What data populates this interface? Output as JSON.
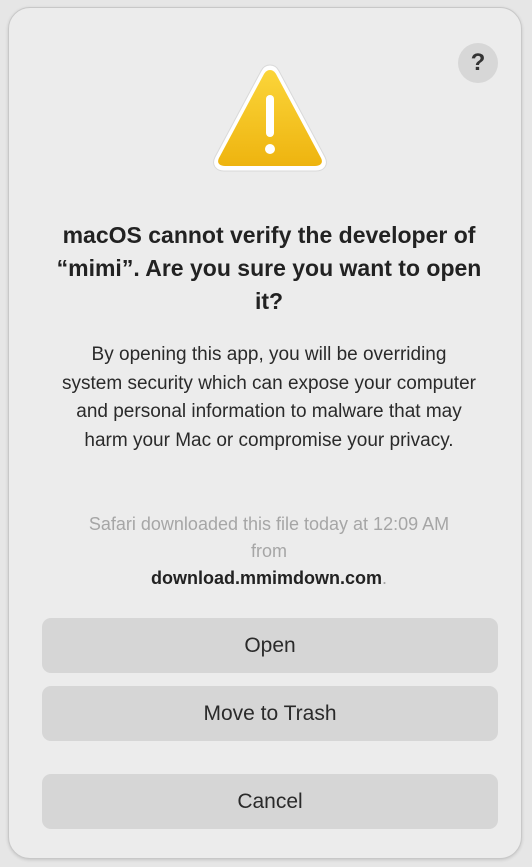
{
  "dialog": {
    "help_label": "?",
    "title": "macOS cannot verify the developer of “mimi”. Are you sure you want to open it?",
    "body": "By opening this app, you will be overriding system security which can expose your computer and personal information to malware that may harm your Mac or compromise your privacy.",
    "source_prefix": "Safari downloaded this file today at 12:09 AM from",
    "source_domain": "download.mmimdown.com",
    "source_suffix": ".",
    "icon": "warning-triangle-icon"
  },
  "buttons": {
    "open": "Open",
    "move_to_trash": "Move to Trash",
    "cancel": "Cancel"
  },
  "colors": {
    "dialog_background": "#ececec",
    "button_background": "#d6d6d6",
    "warning_yellow": "#f7c21b",
    "secondary_text": "#a6a6a6"
  }
}
